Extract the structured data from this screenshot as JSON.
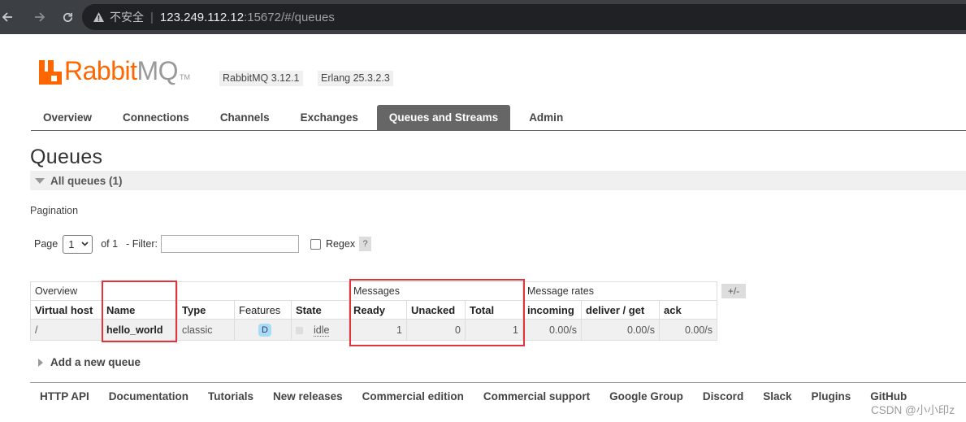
{
  "browser": {
    "insecure_label": "不安全",
    "url_host": "123.249.112.12",
    "url_rest": ":15672/#/queues"
  },
  "header": {
    "logo_rabbit": "Rabbit",
    "logo_mq": "MQ",
    "logo_tm": "TM",
    "version": "RabbitMQ 3.12.1",
    "erlang": "Erlang 25.3.2.3"
  },
  "tabs": [
    {
      "label": "Overview"
    },
    {
      "label": "Connections"
    },
    {
      "label": "Channels"
    },
    {
      "label": "Exchanges"
    },
    {
      "label": "Queues and Streams",
      "active": true
    },
    {
      "label": "Admin"
    }
  ],
  "page": {
    "title": "Queues",
    "section": "All queues (1)",
    "pagination_label": "Pagination",
    "page_label": "Page",
    "page_value": "1",
    "of_label": "of 1",
    "filter_label": "- Filter:",
    "regex_label": "Regex",
    "help": "?"
  },
  "table": {
    "groups": {
      "overview": "Overview",
      "messages": "Messages",
      "rates": "Message rates"
    },
    "columns": [
      "Virtual host",
      "Name",
      "Type",
      "Features",
      "State",
      "Ready",
      "Unacked",
      "Total",
      "incoming",
      "deliver / get",
      "ack"
    ],
    "row": {
      "vhost": "/",
      "name": "hello_world",
      "type": "classic",
      "feature": "D",
      "state": "idle",
      "ready": "1",
      "unacked": "0",
      "total": "1",
      "incoming": "0.00/s",
      "deliver": "0.00/s",
      "ack": "0.00/s"
    },
    "toggle": "+/-"
  },
  "add_queue": "Add a new queue",
  "footer": [
    "HTTP API",
    "Documentation",
    "Tutorials",
    "New releases",
    "Commercial edition",
    "Commercial support",
    "Google Group",
    "Discord",
    "Slack",
    "Plugins",
    "GitHub"
  ],
  "watermark": "CSDN @小小印z",
  "colors": {
    "brand": "#ff6600",
    "highlight": "#e2343d",
    "tab_active": "#666666"
  }
}
